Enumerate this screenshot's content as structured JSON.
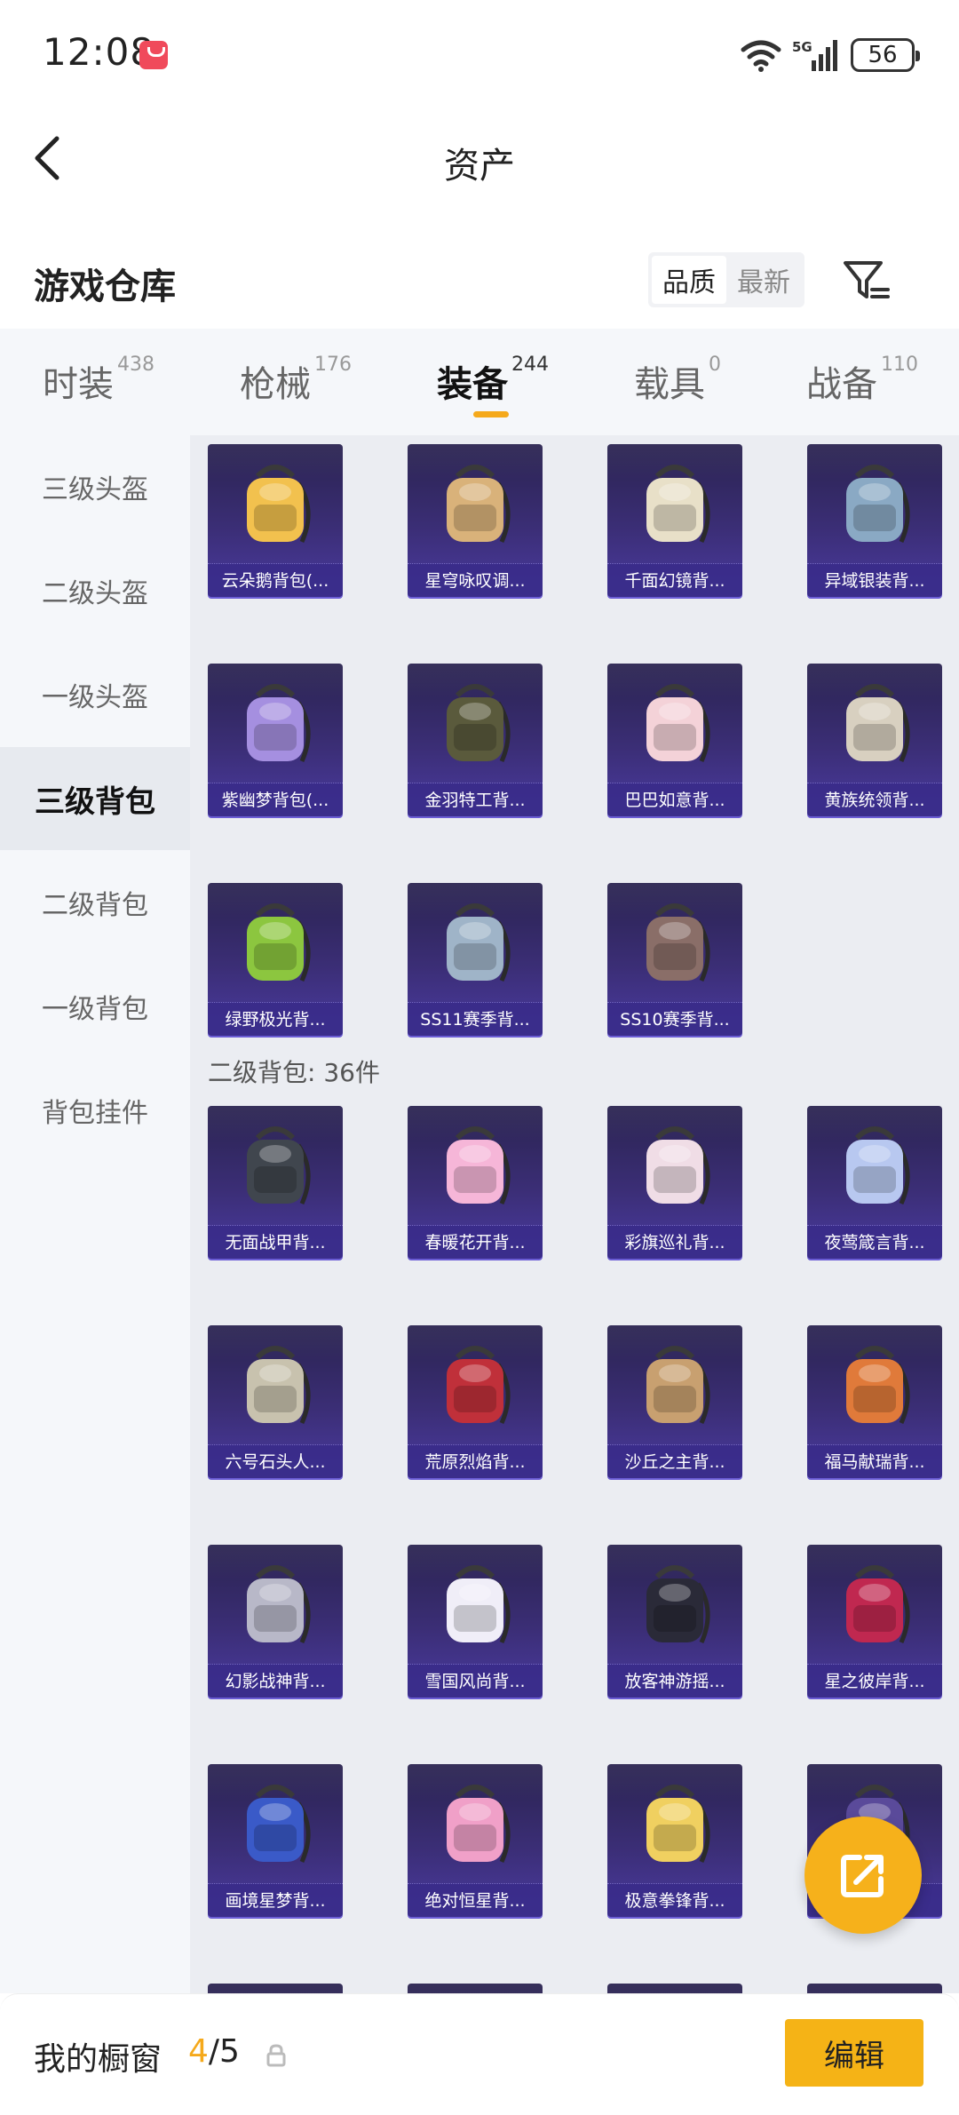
{
  "status_bar": {
    "time": "12:08",
    "network": "5G",
    "battery": "56"
  },
  "header": {
    "title": "资产"
  },
  "warehouse": {
    "title": "游戏仓库",
    "sort_options": [
      "品质",
      "最新"
    ],
    "active_sort": "品质"
  },
  "tabs": [
    {
      "label": "时装",
      "count": "438"
    },
    {
      "label": "枪械",
      "count": "176"
    },
    {
      "label": "装备",
      "count": "244",
      "active": true
    },
    {
      "label": "载具",
      "count": "0"
    },
    {
      "label": "战备",
      "count": "110"
    }
  ],
  "sidebar": {
    "items": [
      "三级头盔",
      "二级头盔",
      "一级头盔",
      "三级背包",
      "二级背包",
      "一级背包",
      "背包挂件"
    ],
    "active": "三级背包"
  },
  "sections": [
    {
      "items": [
        {
          "name": "云朵鹅背包(...",
          "color": "#f2c14e"
        },
        {
          "name": "星穹咏叹调...",
          "color": "#d9b27a"
        },
        {
          "name": "千面幻镜背...",
          "color": "#e8e0c8"
        },
        {
          "name": "异域银装背...",
          "color": "#8aa9c4"
        },
        {
          "name": "紫幽梦背包(...",
          "color": "#a58fe0"
        },
        {
          "name": "金羽特工背...",
          "color": "#5a5a3c"
        },
        {
          "name": "巴巴如意背...",
          "color": "#f4d2d8"
        },
        {
          "name": "黄族统领背...",
          "color": "#d8d0c0"
        },
        {
          "name": "绿野极光背...",
          "color": "#8cc63f"
        },
        {
          "name": "SS11赛季背...",
          "color": "#9fb4c8"
        },
        {
          "name": "SS10赛季背...",
          "color": "#8a6e68"
        }
      ]
    },
    {
      "header": "二级背包: 36件",
      "items": [
        {
          "name": "无面战甲背...",
          "color": "#40464e"
        },
        {
          "name": "春暖花开背...",
          "color": "#f6b6d8"
        },
        {
          "name": "彩旗巡礼背...",
          "color": "#f0dde6"
        },
        {
          "name": "夜莺箴言背...",
          "color": "#b8c8f0"
        },
        {
          "name": "六号石头人...",
          "color": "#c8c2ae"
        },
        {
          "name": "荒原烈焰背...",
          "color": "#c0303a"
        },
        {
          "name": "沙丘之主背...",
          "color": "#c8a070"
        },
        {
          "name": "福马献瑞背...",
          "color": "#e07a3a"
        },
        {
          "name": "幻影战神背...",
          "color": "#b8b8c8"
        },
        {
          "name": "雪国风尚背...",
          "color": "#f0eef8"
        },
        {
          "name": "放客神游摇...",
          "color": "#2a2a38"
        },
        {
          "name": "星之彼岸背...",
          "color": "#c02850"
        },
        {
          "name": "画境星梦背...",
          "color": "#3a5ac8"
        },
        {
          "name": "绝对恒星背...",
          "color": "#f0a0c8"
        },
        {
          "name": "极意拳锋背...",
          "color": "#f0d060"
        },
        {
          "name": "",
          "color": "#5a4a9a"
        },
        {
          "name": "",
          "color": "#3a2e76"
        },
        {
          "name": "",
          "color": "#3a2e76"
        },
        {
          "name": "",
          "color": "#3a2e76"
        },
        {
          "name": "",
          "color": "#3a2e76"
        }
      ]
    }
  ],
  "bottom_bar": {
    "label": "我的橱窗",
    "current": "4",
    "total": "/5",
    "edit_label": "编辑"
  },
  "colors": {
    "accent": "#f5a91b",
    "card_top": "#2a2350",
    "card_bottom": "#4a3aa0"
  }
}
